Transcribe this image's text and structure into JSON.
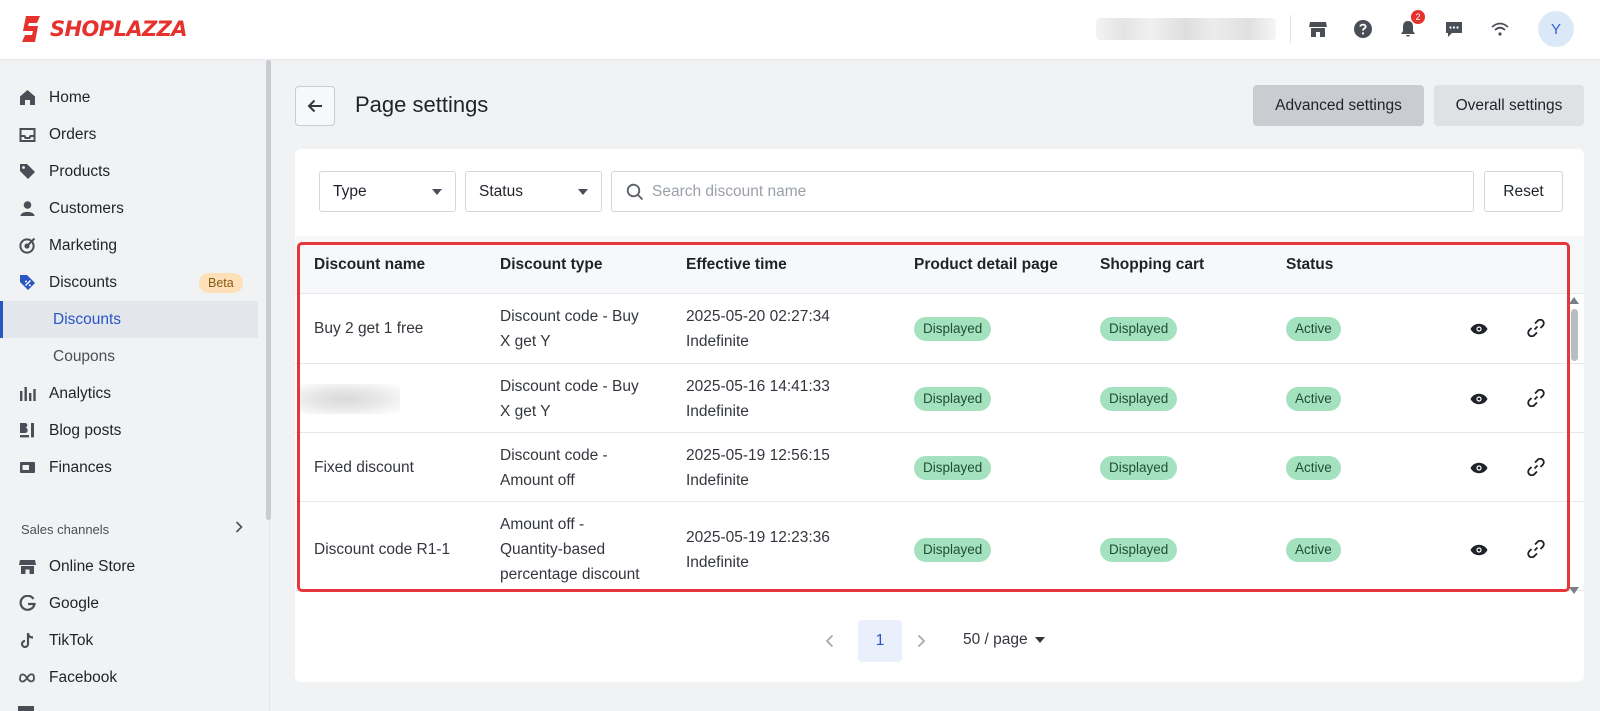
{
  "app": {
    "brand": "SHOPLAZZA",
    "accent_color": "#e5322d",
    "link_color": "#2a55c5"
  },
  "topbar": {
    "icons": [
      "store-icon",
      "help-icon",
      "bell-icon",
      "message-icon",
      "wifi-icon"
    ],
    "notification_count": "2",
    "avatar_initial": "Y"
  },
  "sidebar": {
    "items": [
      {
        "label": "Home",
        "icon": "home-icon"
      },
      {
        "label": "Orders",
        "icon": "inbox-icon"
      },
      {
        "label": "Products",
        "icon": "tag-icon"
      },
      {
        "label": "Customers",
        "icon": "user-icon"
      },
      {
        "label": "Marketing",
        "icon": "target-icon"
      },
      {
        "label": "Discounts",
        "icon": "discount-tag-icon",
        "badge": "Beta"
      },
      {
        "label": "Analytics",
        "icon": "bar-chart-icon"
      },
      {
        "label": "Blog posts",
        "icon": "blog-icon"
      },
      {
        "label": "Finances",
        "icon": "wallet-icon"
      }
    ],
    "discount_subitems": [
      "Discounts",
      "Coupons"
    ],
    "active_subitem": "Discounts",
    "sales_channels_label": "Sales channels",
    "channels": [
      {
        "label": "Online Store",
        "icon": "store-icon"
      },
      {
        "label": "Google",
        "icon": "google-icon"
      },
      {
        "label": "TikTok",
        "icon": "tiktok-icon"
      },
      {
        "label": "Facebook",
        "icon": "meta-icon"
      }
    ]
  },
  "header": {
    "title": "Page settings",
    "advanced_settings_label": "Advanced settings",
    "overall_settings_label": "Overall settings"
  },
  "filters": {
    "type_label": "Type",
    "status_label": "Status",
    "search_placeholder": "Search discount name",
    "reset_label": "Reset"
  },
  "table": {
    "columns": [
      "Discount name",
      "Discount type",
      "Effective time",
      "Product detail page",
      "Shopping cart",
      "Status"
    ],
    "rows": [
      {
        "name": "Buy 2 get 1 free",
        "type_line1": "Discount code - Buy",
        "type_line2": "X get Y",
        "time": "2025-05-20 02:27:34",
        "end": "Indefinite",
        "pdp": "Displayed",
        "cart": "Displayed",
        "status": "Active"
      },
      {
        "name": "",
        "type_line1": "Discount code - Buy",
        "type_line2": "X get Y",
        "time": "2025-05-16 14:41:33",
        "end": "Indefinite",
        "pdp": "Displayed",
        "cart": "Displayed",
        "status": "Active"
      },
      {
        "name": "Fixed discount",
        "type_line1": "Discount code -",
        "type_line2": "Amount off",
        "time": "2025-05-19 12:56:15",
        "end": "Indefinite",
        "pdp": "Displayed",
        "cart": "Displayed",
        "status": "Active"
      },
      {
        "name": "Discount code R1-1",
        "type_line1": "Amount off -",
        "type_line2": "Quantity-based",
        "type_line3": "percentage discount",
        "time": "2025-05-19 12:23:36",
        "end": "Indefinite",
        "pdp": "Displayed",
        "cart": "Displayed",
        "status": "Active"
      }
    ],
    "status_pill_color": "#a4e2bf"
  },
  "pagination": {
    "current_page": "1",
    "page_size": "50 / page"
  }
}
